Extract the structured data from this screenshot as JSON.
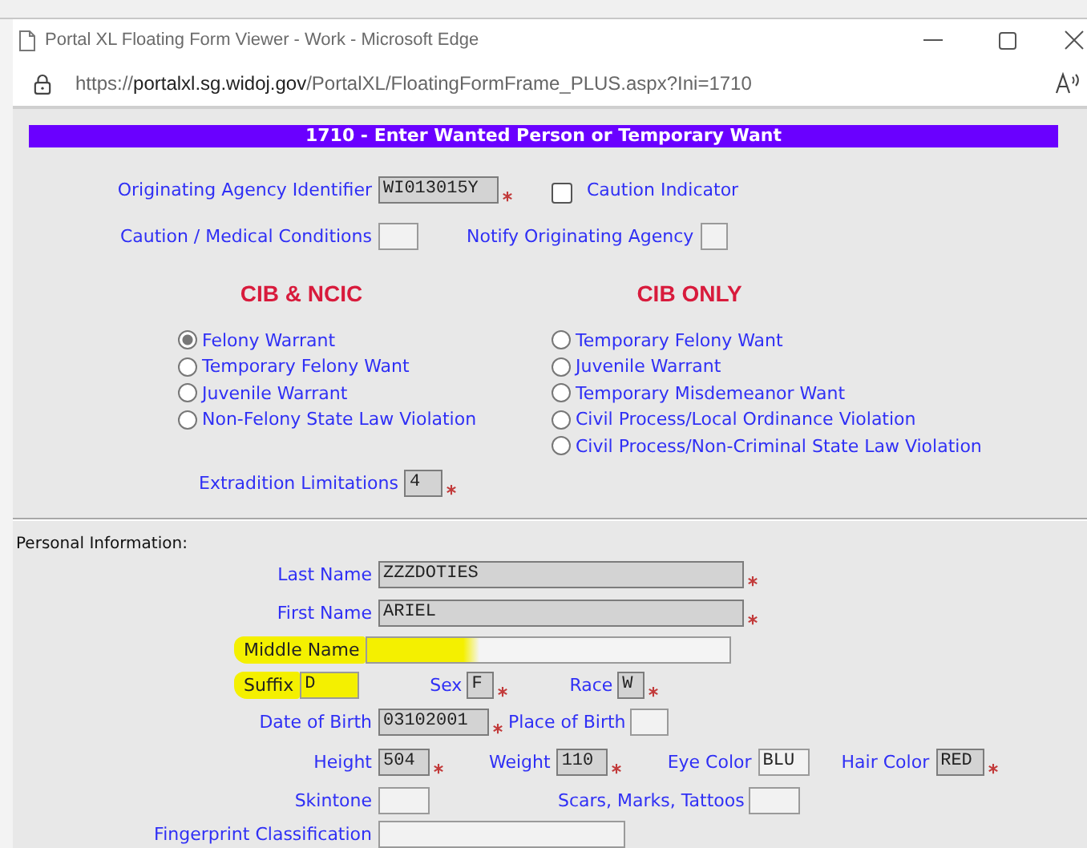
{
  "window": {
    "title": "Portal XL Floating Form Viewer - Work - Microsoft Edge"
  },
  "address_bar": {
    "scheme": "https://",
    "host": "portalxl.sg.widoj.gov",
    "path": "/PortalXL/FloatingFormFrame_PLUS.aspx?Ini=1710"
  },
  "form_title": "1710 - Enter Wanted Person or Temporary Want",
  "originating_agency": {
    "label": "Originating Agency Identifier",
    "value": "WI013015Y",
    "required": true
  },
  "caution_indicator": {
    "label": "Caution Indicator",
    "checked": false
  },
  "caution_medical": {
    "label": "Caution / Medical Conditions",
    "required": false
  },
  "notify_agency": {
    "label": "Notify Originating Agency",
    "required": false
  },
  "groups": [
    {
      "heading": "CIB & NCIC",
      "options": [
        {
          "label": "Felony Warrant",
          "selected": true
        },
        {
          "label": "Temporary Felony Want",
          "selected": false
        },
        {
          "label": "Juvenile Warrant",
          "selected": false
        },
        {
          "label": "Non-Felony State Law Violation",
          "selected": false
        }
      ]
    },
    {
      "heading": "CIB ONLY",
      "options": [
        {
          "label": "Temporary Felony Want",
          "selected": false
        },
        {
          "label": "Juvenile Warrant",
          "selected": false
        },
        {
          "label": "Temporary Misdemeanor Want",
          "selected": false
        },
        {
          "label": "Civil Process/Local Ordinance Violation",
          "selected": false
        },
        {
          "label": "Civil Process/Non-Criminal State Law Violation",
          "selected": false
        }
      ]
    }
  ],
  "extradition": {
    "label": "Extradition Limitations",
    "value": "4",
    "required": true
  },
  "personal": {
    "heading": "Personal Information:",
    "last_name": {
      "label": "Last Name",
      "value": "ZZZDOTIES",
      "required": true,
      "highlighted": false
    },
    "first_name": {
      "label": "First Name",
      "value": "ARIEL",
      "required": true,
      "highlighted": false
    },
    "middle_name": {
      "label": "Middle Name",
      "required": false,
      "highlighted": true
    },
    "suffix": {
      "label": "Suffix",
      "value": "D",
      "required": false,
      "highlighted": true
    },
    "sex": {
      "label": "Sex",
      "value": "F",
      "required": true,
      "highlighted": false
    },
    "race": {
      "label": "Race",
      "value": "W",
      "required": true,
      "highlighted": false
    },
    "date_of_birth": {
      "label": "Date of Birth",
      "value": "03102001",
      "required": true,
      "highlighted": false
    },
    "place_of_birth": {
      "label": "Place of Birth",
      "required": false,
      "highlighted": false
    },
    "height": {
      "label": "Height",
      "value": "504",
      "required": true,
      "highlighted": false
    },
    "weight": {
      "label": "Weight",
      "value": "110",
      "required": true,
      "highlighted": false
    },
    "eye_color": {
      "label": "Eye Color",
      "value": "BLU",
      "required": false,
      "highlighted": false
    },
    "hair_color": {
      "label": "Hair Color",
      "value": "RED",
      "required": true,
      "highlighted": false
    },
    "skintone": {
      "label": "Skintone",
      "required": false,
      "highlighted": false
    },
    "scars_marks_tattoos": {
      "label": "Scars, Marks, Tattoos",
      "required": false,
      "highlighted": false
    },
    "fingerprint_classification": {
      "label": "Fingerprint Classification",
      "required": false,
      "highlighted": false
    }
  }
}
